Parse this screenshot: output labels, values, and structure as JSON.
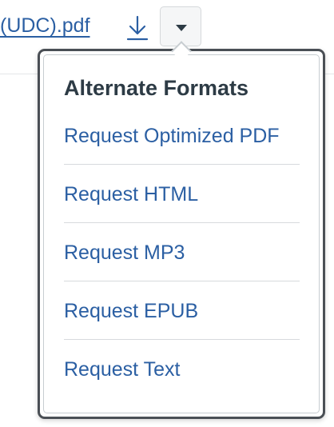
{
  "file": {
    "link_text": "(UDC).pdf"
  },
  "icons": {
    "download": "download-arrow-icon",
    "dropdown": "caret-down-icon"
  },
  "popover": {
    "title": "Alternate Formats",
    "items": [
      {
        "label": "Request Optimized PDF"
      },
      {
        "label": "Request HTML"
      },
      {
        "label": "Request MP3"
      },
      {
        "label": "Request EPUB"
      },
      {
        "label": "Request Text"
      }
    ]
  },
  "colors": {
    "link": "#2b5fa3",
    "title": "#2d3b45",
    "popover_border": "#4a4f55"
  }
}
